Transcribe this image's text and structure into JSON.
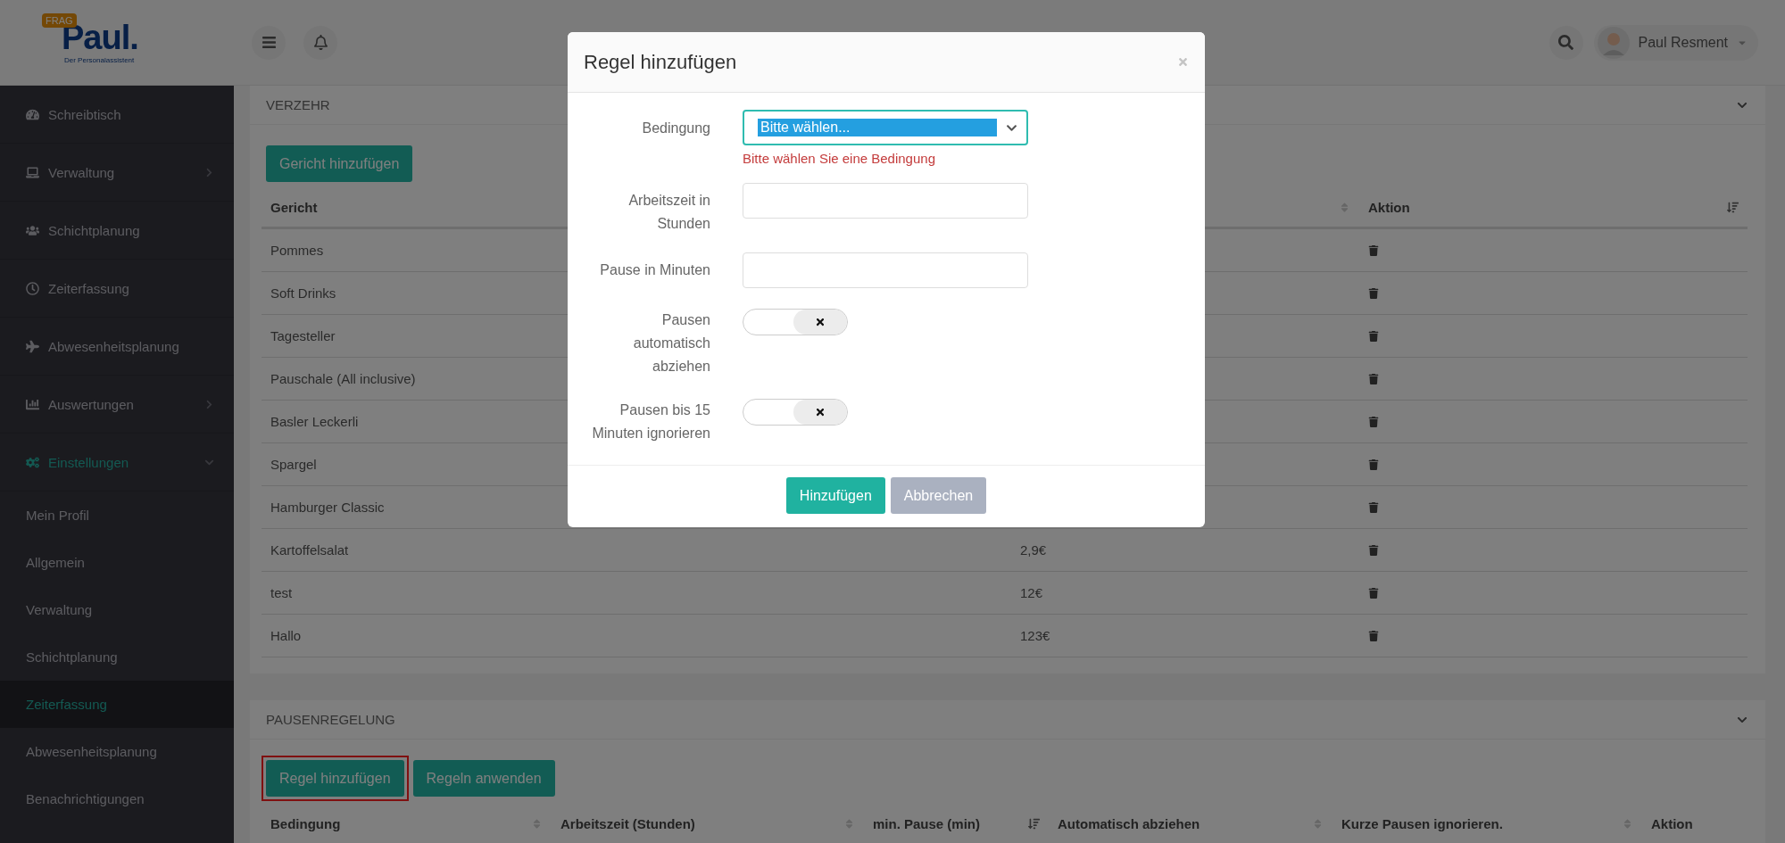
{
  "header": {
    "logo": {
      "badge": "FRAG",
      "name": "Paul.",
      "tagline": "Der Personalassistent"
    },
    "user": {
      "name": "Paul Resment"
    }
  },
  "sidebar": {
    "items": [
      {
        "label": "Schreibtisch",
        "selected": false
      },
      {
        "label": "Verwaltung",
        "selected": false,
        "expanded": false
      },
      {
        "label": "Schichtplanung",
        "selected": false
      },
      {
        "label": "Zeiterfassung",
        "selected": false
      },
      {
        "label": "Abwesenheitsplanung",
        "selected": false
      },
      {
        "label": "Auswertungen",
        "selected": false,
        "expanded": false
      },
      {
        "label": "Einstellungen",
        "selected": true,
        "expanded": true,
        "children": [
          {
            "label": "Mein Profil",
            "selected": false
          },
          {
            "label": "Allgemein",
            "selected": false
          },
          {
            "label": "Verwaltung",
            "selected": false
          },
          {
            "label": "Schichtplanung",
            "selected": false
          },
          {
            "label": "Zeiterfassung",
            "selected": true
          },
          {
            "label": "Abwesenheitsplanung",
            "selected": false
          },
          {
            "label": "Benachrichtigungen",
            "selected": false
          }
        ]
      }
    ]
  },
  "verzehr": {
    "title": "VERZEHR",
    "buttons": [
      {
        "label": "Gericht hinzufügen",
        "highlighted": false
      }
    ],
    "columns": [
      {
        "label": "Gericht"
      },
      {
        "sorted": false
      },
      {
        "label": "Aktion",
        "sorted": true
      }
    ],
    "rows": [
      {
        "name": "Pommes"
      },
      {
        "name": "Soft Drinks"
      },
      {
        "name": "Tagesteller"
      },
      {
        "name": "Pauschale (All inclusive)"
      },
      {
        "name": "Basler Leckerli"
      },
      {
        "name": "Spargel"
      },
      {
        "name": "Hamburger Classic"
      },
      {
        "name": "Kartoffelsalat",
        "price": "2,9€"
      },
      {
        "name": "test",
        "price": "12€"
      },
      {
        "name": "Hallo",
        "price": "123€"
      }
    ]
  },
  "pausenregelung": {
    "title": "PAUSENREGELUNG",
    "buttons": [
      {
        "label": "Regel hinzufügen",
        "highlighted": true
      },
      {
        "label": "Regeln anwenden",
        "highlighted": false
      }
    ],
    "columns": [
      {
        "label": "Bedingung",
        "sorted": false
      },
      {
        "label": "Arbeitszeit (Stunden)",
        "sorted": false
      },
      {
        "label": "min. Pause (min)",
        "sorted": true
      },
      {
        "label": "Automatisch abziehen",
        "sorted": false
      },
      {
        "label": "Kurze Pausen ignorieren.",
        "sorted": false
      },
      {
        "label": "Aktion"
      }
    ]
  },
  "modal": {
    "title": "Regel hinzufügen",
    "fields": [
      {
        "kind": "select",
        "label": "Bedingung",
        "value": "Bitte wählen...",
        "error": "Bitte wählen Sie eine Bedingung"
      },
      {
        "kind": "input",
        "label": "Arbeitszeit in Stunden"
      },
      {
        "kind": "input",
        "label": "Pause in Minuten"
      },
      {
        "kind": "toggle",
        "label": "Pausen automatisch abziehen",
        "on": false
      },
      {
        "kind": "toggle",
        "label": "Pausen bis 15 Minuten ignorieren",
        "on": false
      }
    ],
    "buttons": [
      {
        "label": "Hinzufügen",
        "primary": true
      },
      {
        "label": "Abbrechen",
        "primary": false
      }
    ]
  }
}
